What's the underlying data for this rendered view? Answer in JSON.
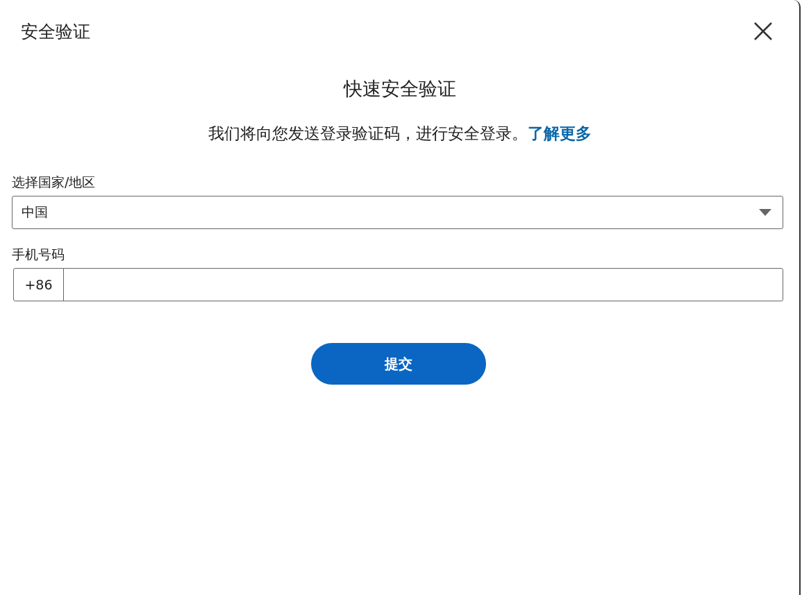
{
  "dialog": {
    "title": "安全验证"
  },
  "heading": "快速安全验证",
  "description": "我们将向您发送登录验证码，进行安全登录。",
  "learn_more_link": "了解更多",
  "country_field": {
    "label": "选择国家/地区",
    "value": "中国"
  },
  "phone_field": {
    "label": "手机号码",
    "prefix": "+86"
  },
  "submit_button": "提交"
}
